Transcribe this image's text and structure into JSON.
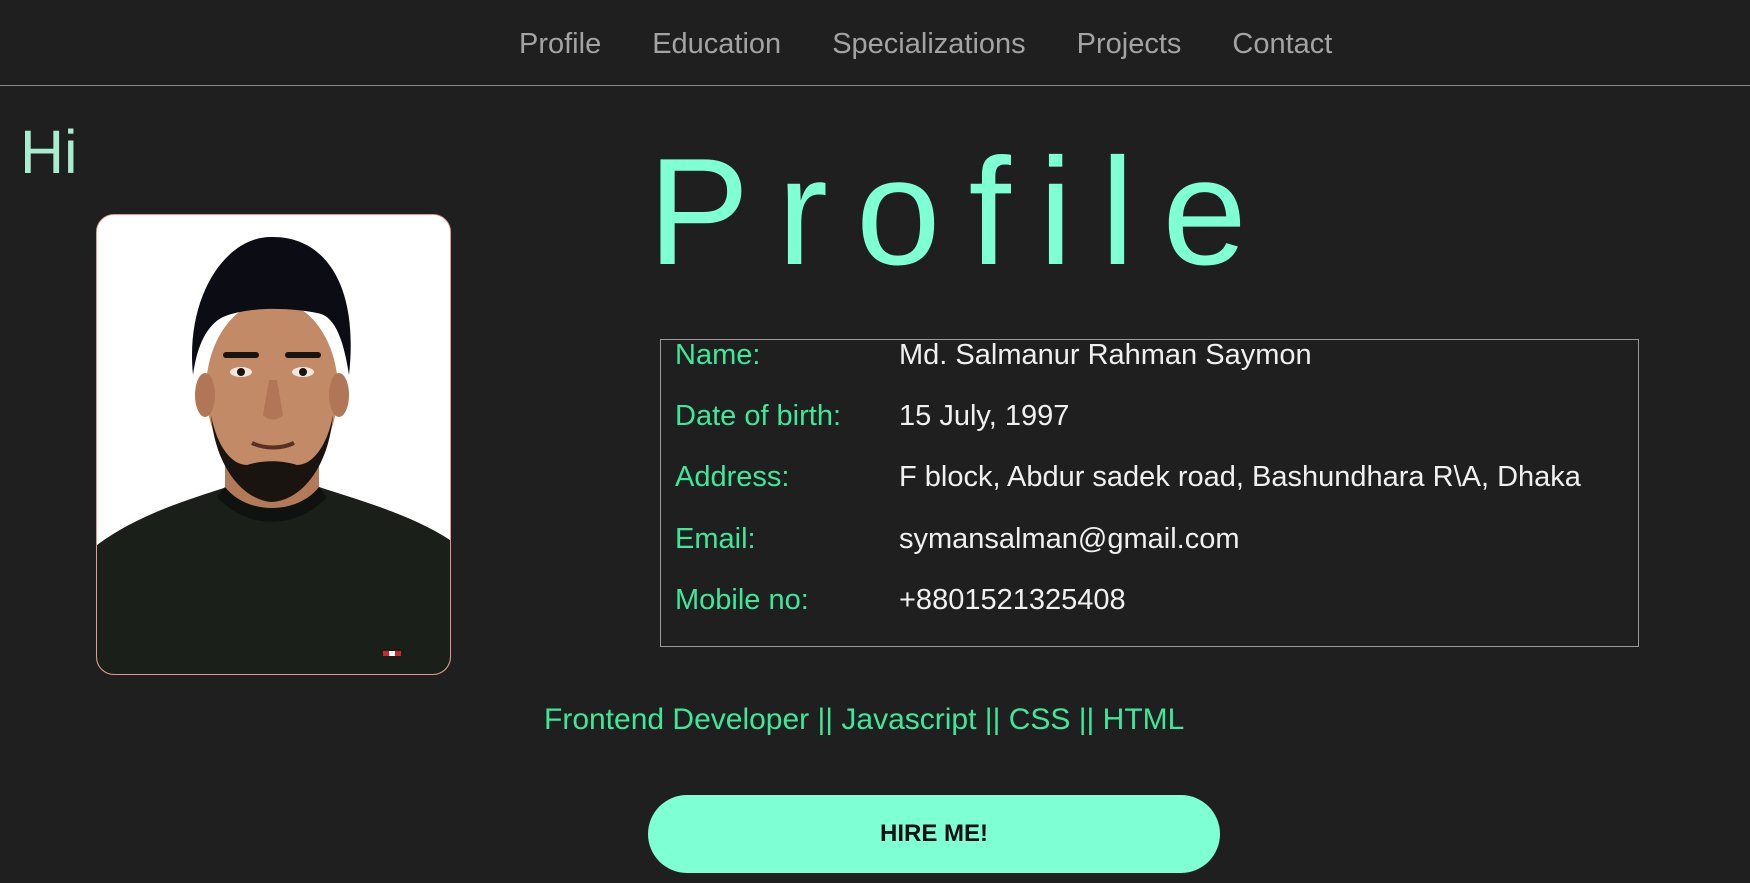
{
  "nav": {
    "items": [
      {
        "label": "Profile"
      },
      {
        "label": "Education"
      },
      {
        "label": "Specializations"
      },
      {
        "label": "Projects"
      },
      {
        "label": "Contact"
      }
    ]
  },
  "greeting": "Hi",
  "profile": {
    "heading": "Profile",
    "fields": [
      {
        "label": "Name:",
        "value": "Md. Salmanur Rahman Saymon"
      },
      {
        "label": "Date of birth:",
        "value": "15 July, 1997"
      },
      {
        "label": "Address:",
        "value": "F block, Abdur sadek road, Bashundhara R\\A, Dhaka"
      },
      {
        "label": "Email:",
        "value": "symansalman@gmail.com"
      },
      {
        "label": "Mobile no:",
        "value": "+8801521325408"
      }
    ],
    "tagline": "Frontend Developer || Javascript || CSS || HTML",
    "hire_button": "HIRE ME!"
  },
  "colors": {
    "background": "#1f1f1f",
    "accent": "#7fffd4",
    "label_green": "#3ee89b",
    "nav_text": "#a3a3a3",
    "photo_border": "#e49a8a"
  },
  "icons": {
    "photo": "profile-photo"
  }
}
